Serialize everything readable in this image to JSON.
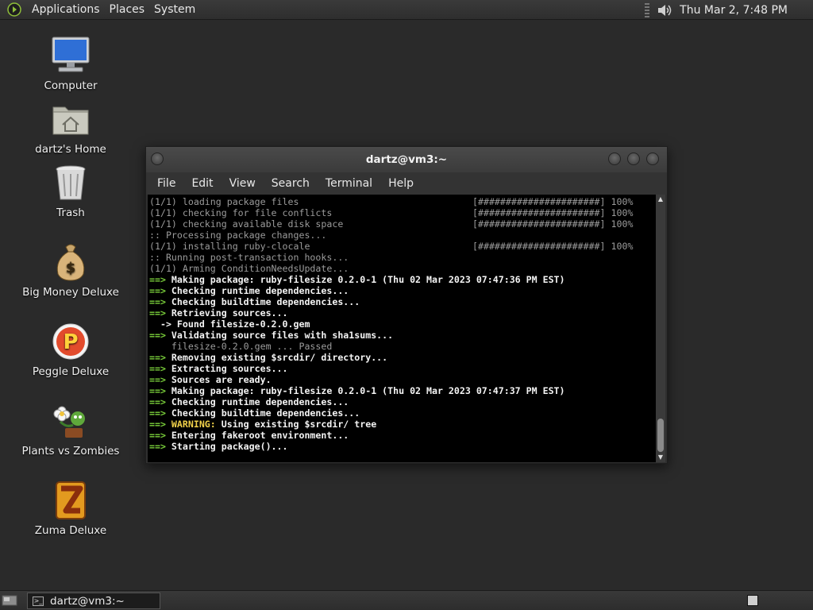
{
  "top_panel": {
    "menus": [
      "Applications",
      "Places",
      "System"
    ],
    "clock": "Thu Mar  2,  7:48 PM"
  },
  "desktop_icons": [
    {
      "label": "Computer",
      "icon": "computer-icon"
    },
    {
      "label": "dartz's Home",
      "icon": "home-folder-icon"
    },
    {
      "label": "Trash",
      "icon": "trash-icon"
    },
    {
      "label": "Big Money Deluxe",
      "icon": "money-bag-icon"
    },
    {
      "label": "Peggle Deluxe",
      "icon": "peggle-icon"
    },
    {
      "label": "Plants vs Zombies",
      "icon": "plants-icon"
    },
    {
      "label": "Zuma Deluxe",
      "icon": "zuma-icon"
    }
  ],
  "terminal": {
    "title": "dartz@vm3:~",
    "menu": [
      "File",
      "Edit",
      "View",
      "Search",
      "Terminal",
      "Help"
    ],
    "lines": [
      {
        "text": "(1/1) loading package files",
        "style": "dim",
        "progress": "[######################] 100%"
      },
      {
        "text": "(1/1) checking for file conflicts",
        "style": "dim",
        "progress": "[######################] 100%"
      },
      {
        "text": "(1/1) checking available disk space",
        "style": "dim",
        "progress": "[######################] 100%"
      },
      {
        "text": ":: Processing package changes...",
        "style": "dim"
      },
      {
        "text": "(1/1) installing ruby-clocale",
        "style": "dim",
        "progress": "[######################] 100%"
      },
      {
        "text": ":: Running post-transaction hooks...",
        "style": "dim"
      },
      {
        "text": "(1/1) Arming ConditionNeedsUpdate...",
        "style": "dim"
      },
      {
        "prefix": "==> ",
        "text": "Making package: ruby-filesize 0.2.0-1 (Thu 02 Mar 2023 07:47:36 PM EST)",
        "style": "bold"
      },
      {
        "prefix": "==> ",
        "text": "Checking runtime dependencies...",
        "style": "bold"
      },
      {
        "prefix": "==> ",
        "text": "Checking buildtime dependencies...",
        "style": "bold"
      },
      {
        "prefix": "==> ",
        "text": "Retrieving sources...",
        "style": "bold"
      },
      {
        "text": "  -> Found filesize-0.2.0.gem",
        "style": "bold"
      },
      {
        "prefix": "==> ",
        "text": "Validating source files with sha1sums...",
        "style": "bold"
      },
      {
        "text": "    filesize-0.2.0.gem ... Passed",
        "style": "dim"
      },
      {
        "prefix": "==> ",
        "text": "Removing existing $srcdir/ directory...",
        "style": "bold"
      },
      {
        "prefix": "==> ",
        "text": "Extracting sources...",
        "style": "bold"
      },
      {
        "prefix": "==> ",
        "text": "Sources are ready.",
        "style": "bold"
      },
      {
        "prefix": "==> ",
        "text": "Making package: ruby-filesize 0.2.0-1 (Thu 02 Mar 2023 07:47:37 PM EST)",
        "style": "bold"
      },
      {
        "prefix": "==> ",
        "text": "Checking runtime dependencies...",
        "style": "bold"
      },
      {
        "prefix": "==> ",
        "text": "Checking buildtime dependencies...",
        "style": "bold"
      },
      {
        "prefix": "==> ",
        "warn": "WARNING:",
        "text": " Using existing $srcdir/ tree",
        "style": "bold"
      },
      {
        "prefix": "==> ",
        "text": "Entering fakeroot environment...",
        "style": "bold"
      },
      {
        "prefix": "==> ",
        "text": "Starting package()...",
        "style": "bold"
      }
    ]
  },
  "taskbar": {
    "window_label": "dartz@vm3:~"
  },
  "colors": {
    "desktop": "#2a2a2a",
    "arrow": "#7bd13b",
    "warning": "#f1d14a",
    "terminal_bg": "#000000"
  }
}
